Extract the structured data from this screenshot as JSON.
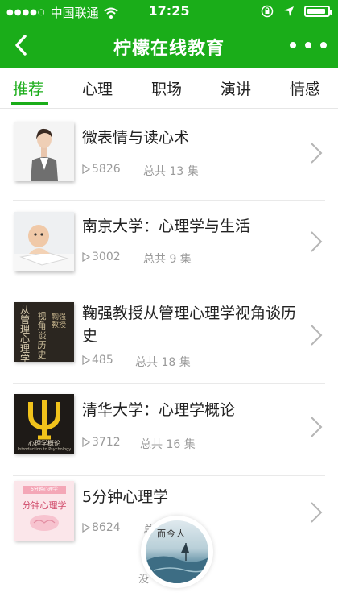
{
  "status_bar": {
    "signal_dots": "●●●●○",
    "carrier": "中国联通",
    "time": "17:25"
  },
  "nav": {
    "title": "柠檬在线教育"
  },
  "tabs": [
    {
      "label": "推荐",
      "active": true
    },
    {
      "label": "心理",
      "active": false
    },
    {
      "label": "职场",
      "active": false
    },
    {
      "label": "演讲",
      "active": false
    },
    {
      "label": "情感",
      "active": false
    }
  ],
  "courses": [
    {
      "title": "微表情与读心术",
      "plays": "5826",
      "total": "总共 13 集"
    },
    {
      "title": "南京大学：心理学与生活",
      "plays": "3002",
      "total": "总共 9 集"
    },
    {
      "title": "鞠强教授从管理心理学视角谈历史",
      "plays": "485",
      "total": "总共 18 集",
      "thumb_text": [
        "从",
        "管",
        "理",
        "心",
        "理",
        "学"
      ],
      "thumb_text2": [
        "视",
        "角",
        "谈",
        "历",
        "史"
      ],
      "thumb_text3": "鞠强教授"
    },
    {
      "title": "清华大学：心理学概论",
      "plays": "3712",
      "total": "总共 16 集",
      "thumb_text": "心理学概论",
      "thumb_sub": "Introduction to Psychology"
    },
    {
      "title": "5分钟心理学",
      "plays": "8624",
      "total": "总",
      "thumb_text": "分钟心理学",
      "thumb_top": "5分钟心理学"
    }
  ],
  "bottom_hint": "没",
  "player": {
    "disc_text": "而今人"
  },
  "colors": {
    "brand": "#1aad19",
    "muted": "#9a9a9a",
    "text": "#222222"
  }
}
